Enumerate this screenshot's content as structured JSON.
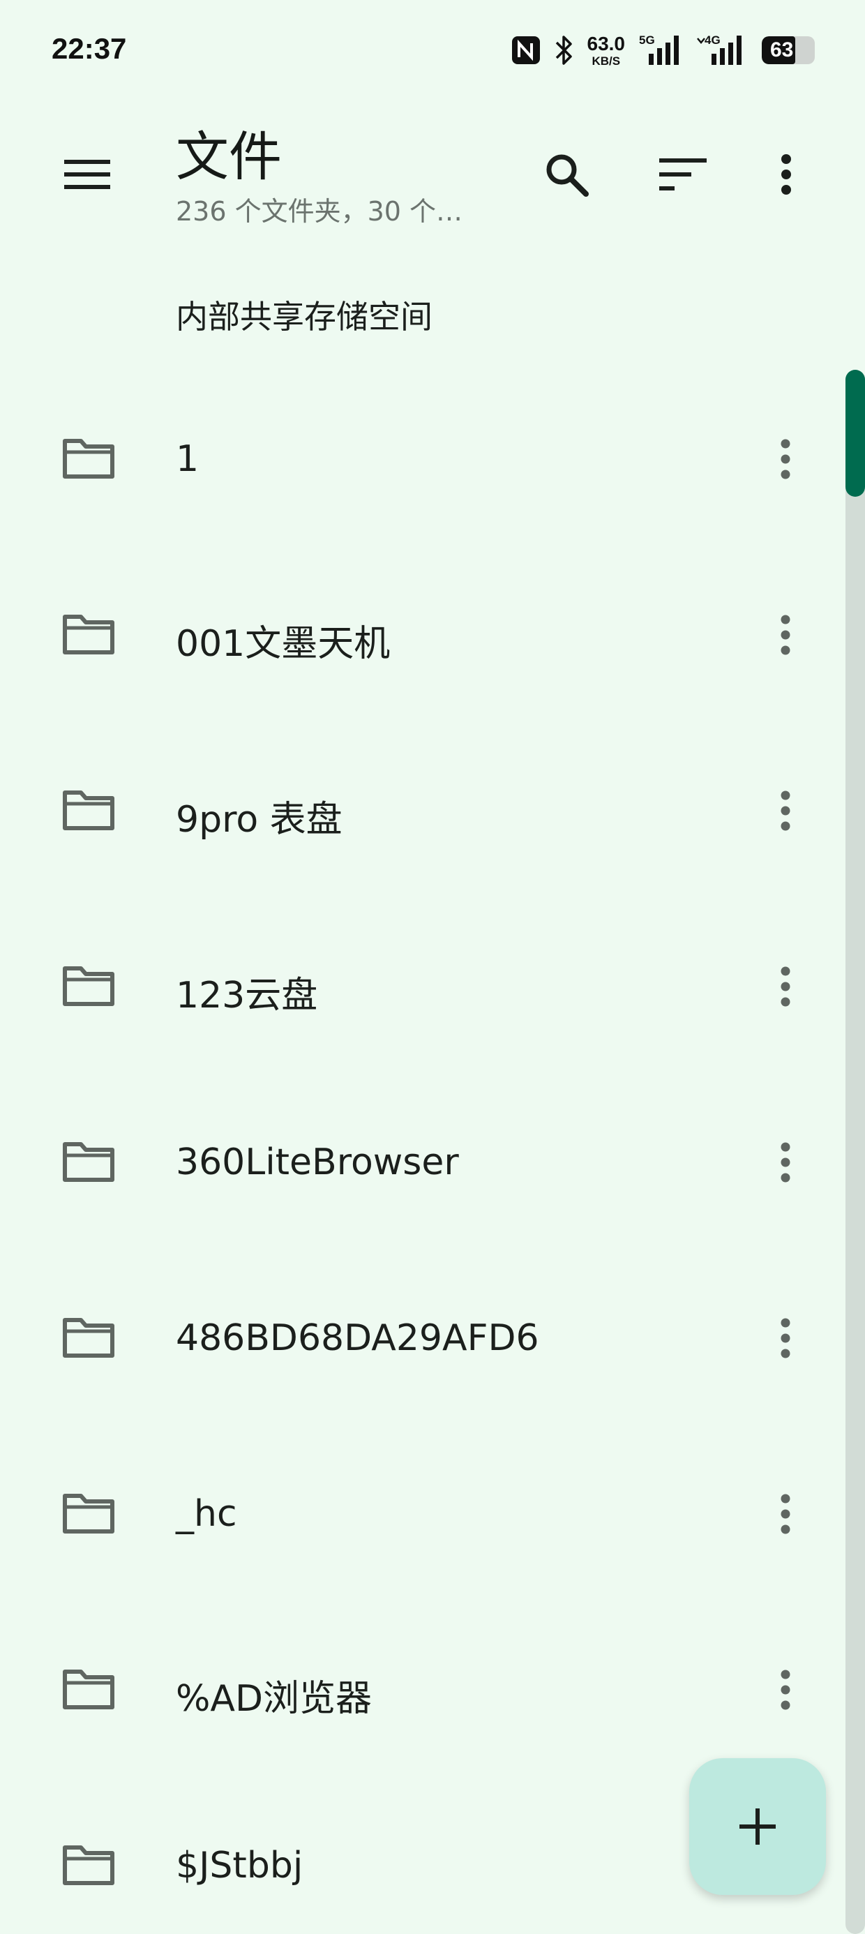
{
  "status_bar": {
    "time": "22:37",
    "net_speed_value": "63.0",
    "net_speed_unit": "KB/S",
    "signal_1_label": "5G",
    "signal_2_label": "4G",
    "battery_level": "63",
    "battery_fraction": 0.63,
    "icons": [
      "nfc-icon",
      "bluetooth-icon",
      "signal-5g-icon",
      "signal-4g-icon",
      "battery-icon"
    ]
  },
  "app_bar": {
    "title": "文件",
    "subtitle": "236 个文件夹，30 个…",
    "icons": [
      "menu-icon",
      "search-icon",
      "sort-icon",
      "more-vert-icon"
    ]
  },
  "storage_label": "内部共享存储空间",
  "files": [
    {
      "name": "1",
      "icon": "folder-icon"
    },
    {
      "name": "001文墨天机",
      "icon": "folder-icon"
    },
    {
      "name": "9pro 表盘",
      "icon": "folder-icon"
    },
    {
      "name": "123云盘",
      "icon": "folder-icon"
    },
    {
      "name": "360LiteBrowser",
      "icon": "folder-icon"
    },
    {
      "name": "486BD68DA29AFD6",
      "icon": "folder-icon"
    },
    {
      "name": "_hc",
      "icon": "folder-icon"
    },
    {
      "name": "%AD浏览器",
      "icon": "folder-icon"
    },
    {
      "name": "$JStbbj",
      "icon": "folder-icon"
    }
  ],
  "fab": {
    "icon": "add-icon"
  },
  "colors": {
    "background": "#eefaf1",
    "accent": "#006b4f",
    "fab": "#bde9df",
    "icon_gray": "#5f6661"
  }
}
